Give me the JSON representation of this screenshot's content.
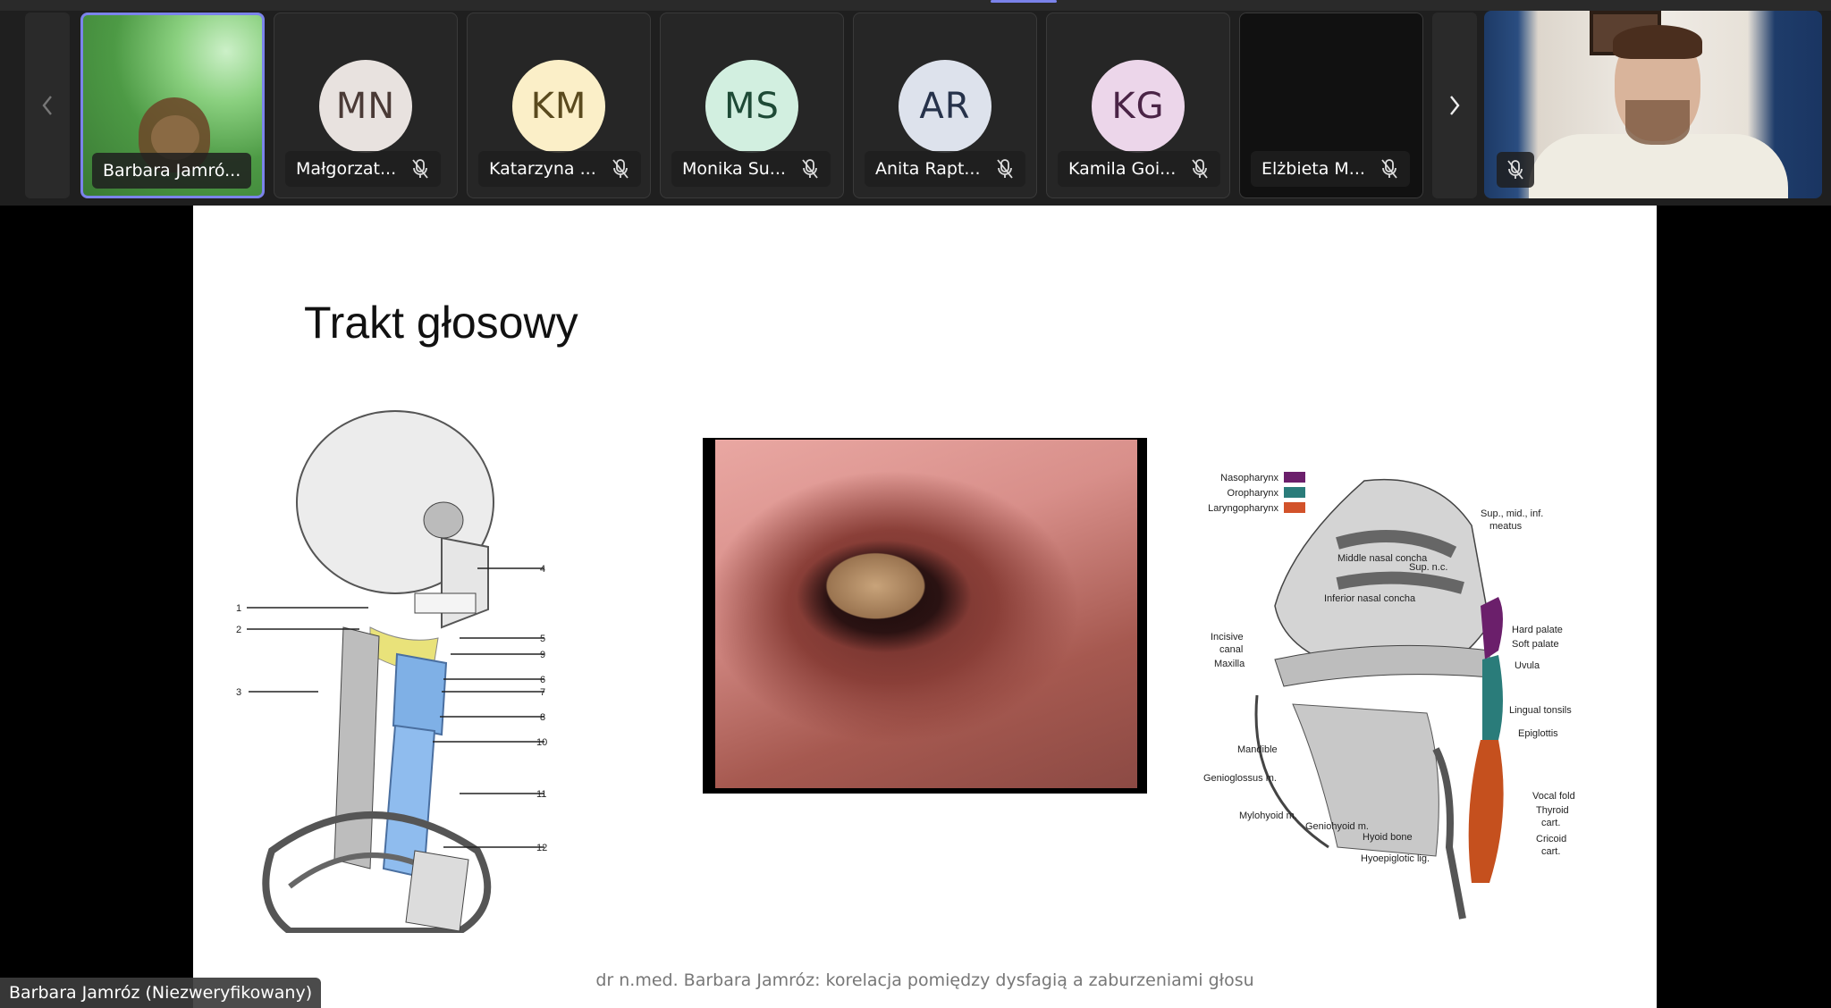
{
  "participants": [
    {
      "name": "Barbara Jamró...",
      "initials": "",
      "muted": false,
      "video": true,
      "active": true
    },
    {
      "name": "Małgorzat...",
      "initials": "MN",
      "muted": true,
      "avatar_bg": "#e8e2df",
      "avatar_fg": "#4a3a36"
    },
    {
      "name": "Katarzyna ...",
      "initials": "KM",
      "muted": true,
      "avatar_bg": "#fbefc8",
      "avatar_fg": "#5a4a1e"
    },
    {
      "name": "Monika Su...",
      "initials": "MS",
      "muted": true,
      "avatar_bg": "#d2efe0",
      "avatar_fg": "#1e4a36"
    },
    {
      "name": "Anita Rapt...",
      "initials": "AR",
      "muted": true,
      "avatar_bg": "#dde2ec",
      "avatar_fg": "#26324a"
    },
    {
      "name": "Kamila Goi...",
      "initials": "KG",
      "muted": true,
      "avatar_bg": "#ecd6ea",
      "avatar_fg": "#4a2446"
    },
    {
      "name": "Elżbieta M...",
      "initials": "",
      "muted": true,
      "video": false
    }
  ],
  "icons": {
    "prev": "chevron-left-icon",
    "next": "chevron-right-icon",
    "mic_off": "mic-off-icon"
  },
  "accent_color": "#7b83eb",
  "slide": {
    "title": "Trakt głosowy",
    "footer": "dr n.med. Barbara Jamróz: korelacja pomiędzy dysfagią a zaburzeniami głosu",
    "skeleton_labels": [
      "1",
      "2",
      "3",
      "4",
      "5",
      "9",
      "6",
      "7",
      "8",
      "10",
      "11",
      "12"
    ],
    "throat_legend": [
      "Nasopharynx",
      "Oropharynx",
      "Laryngopharynx"
    ],
    "throat_legend_colors": [
      "#6b1f6b",
      "#2a7c7a",
      "#d2522a"
    ],
    "throat_labels": {
      "meatus": "Sup., mid., inf.",
      "meatus2": "meatus",
      "sup_nc": "Sup. n.c.",
      "middle": "Middle nasal concha",
      "inferior": "Inferior nasal concha",
      "hard_palate": "Hard palate",
      "soft_palate": "Soft palate",
      "incisive": "Incisive",
      "canal": "canal",
      "maxilla": "Maxilla",
      "uvula": "Uvula",
      "lingual": "Lingual tonsils",
      "epiglottis": "Epiglottis",
      "mandible": "Mandible",
      "genioglossus": "Genioglossus m.",
      "mylohyoid": "Mylohyoid m.",
      "geniohyoid": "Geniohyoid m.",
      "hyoid": "Hyoid bone",
      "hyoepiglottic": "Hyoepiglotic lig.",
      "vocal": "Vocal fold",
      "thyroid": "Thyroid",
      "thyroid2": "cart.",
      "cricoid": "Cricoid",
      "cricoid2": "cart."
    }
  },
  "caption": "Barbara Jamróz (Niezweryfikowany)"
}
